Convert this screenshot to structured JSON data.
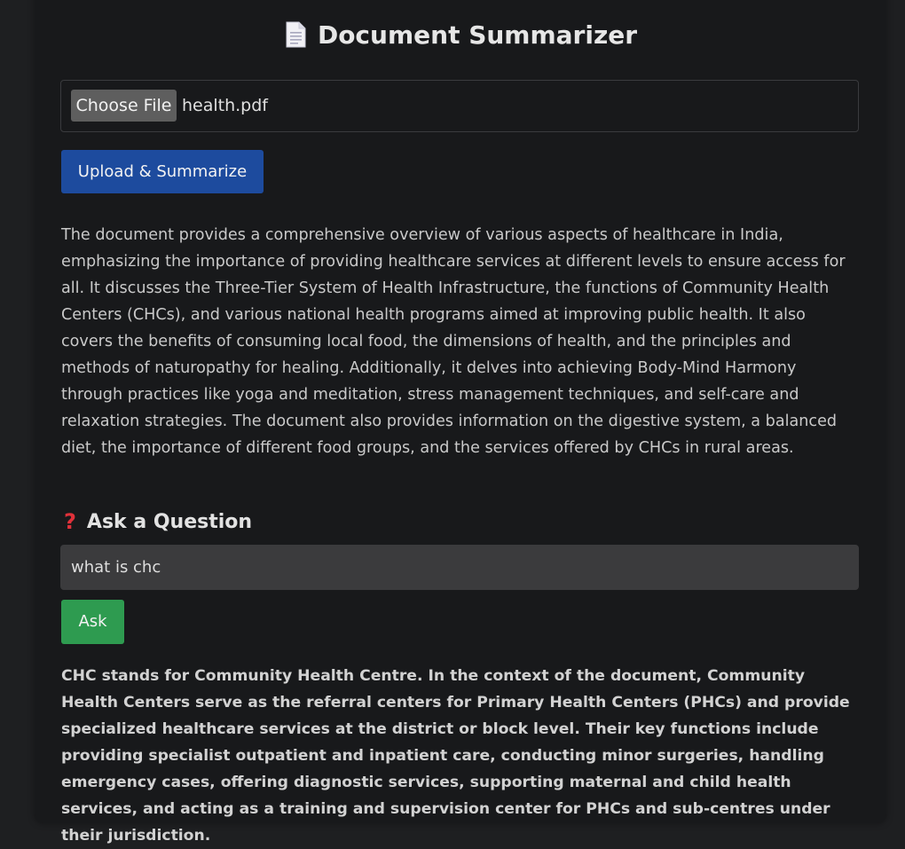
{
  "header": {
    "icon": "document-icon",
    "title": "Document Summarizer"
  },
  "upload": {
    "choose_label": "Choose File",
    "file_name": "health.pdf",
    "submit_label": "Upload & Summarize"
  },
  "summary": {
    "text": "The document provides a comprehensive overview of various aspects of healthcare in India, emphasizing the importance of providing healthcare services at different levels to ensure access for all. It discusses the Three-Tier System of Health Infrastructure, the functions of Community Health Centers (CHCs), and various national health programs aimed at improving public health. It also covers the benefits of consuming local food, the dimensions of health, and the principles and methods of naturopathy for healing. Additionally, it delves into achieving Body-Mind Harmony through practices like yoga and meditation, stress management techniques, and self-care and relaxation strategies. The document also provides information on the digestive system, a balanced diet, the importance of different food groups, and the services offered by CHCs in rural areas."
  },
  "question": {
    "icon": "question-mark-icon",
    "heading": "Ask a Question",
    "input_value": "what is chc",
    "ask_label": "Ask"
  },
  "answer": {
    "text": "CHC stands for Community Health Centre. In the context of the document, Community Health Centers serve as the referral centers for Primary Health Centers (PHCs) and provide specialized healthcare services at the district or block level. Their key functions include providing specialist outpatient and inpatient care, conducting minor surgeries, handling emergency cases, offering diagnostic services, supporting maternal and child health services, and acting as a training and supervision center for PHCs and sub-centres under their jurisdiction."
  },
  "colors": {
    "page_background": "#1e1f21",
    "card_background": "#18191b",
    "upload_button": "#1d4b9e",
    "ask_button": "#2e9b50",
    "question_icon": "#e0313a"
  }
}
